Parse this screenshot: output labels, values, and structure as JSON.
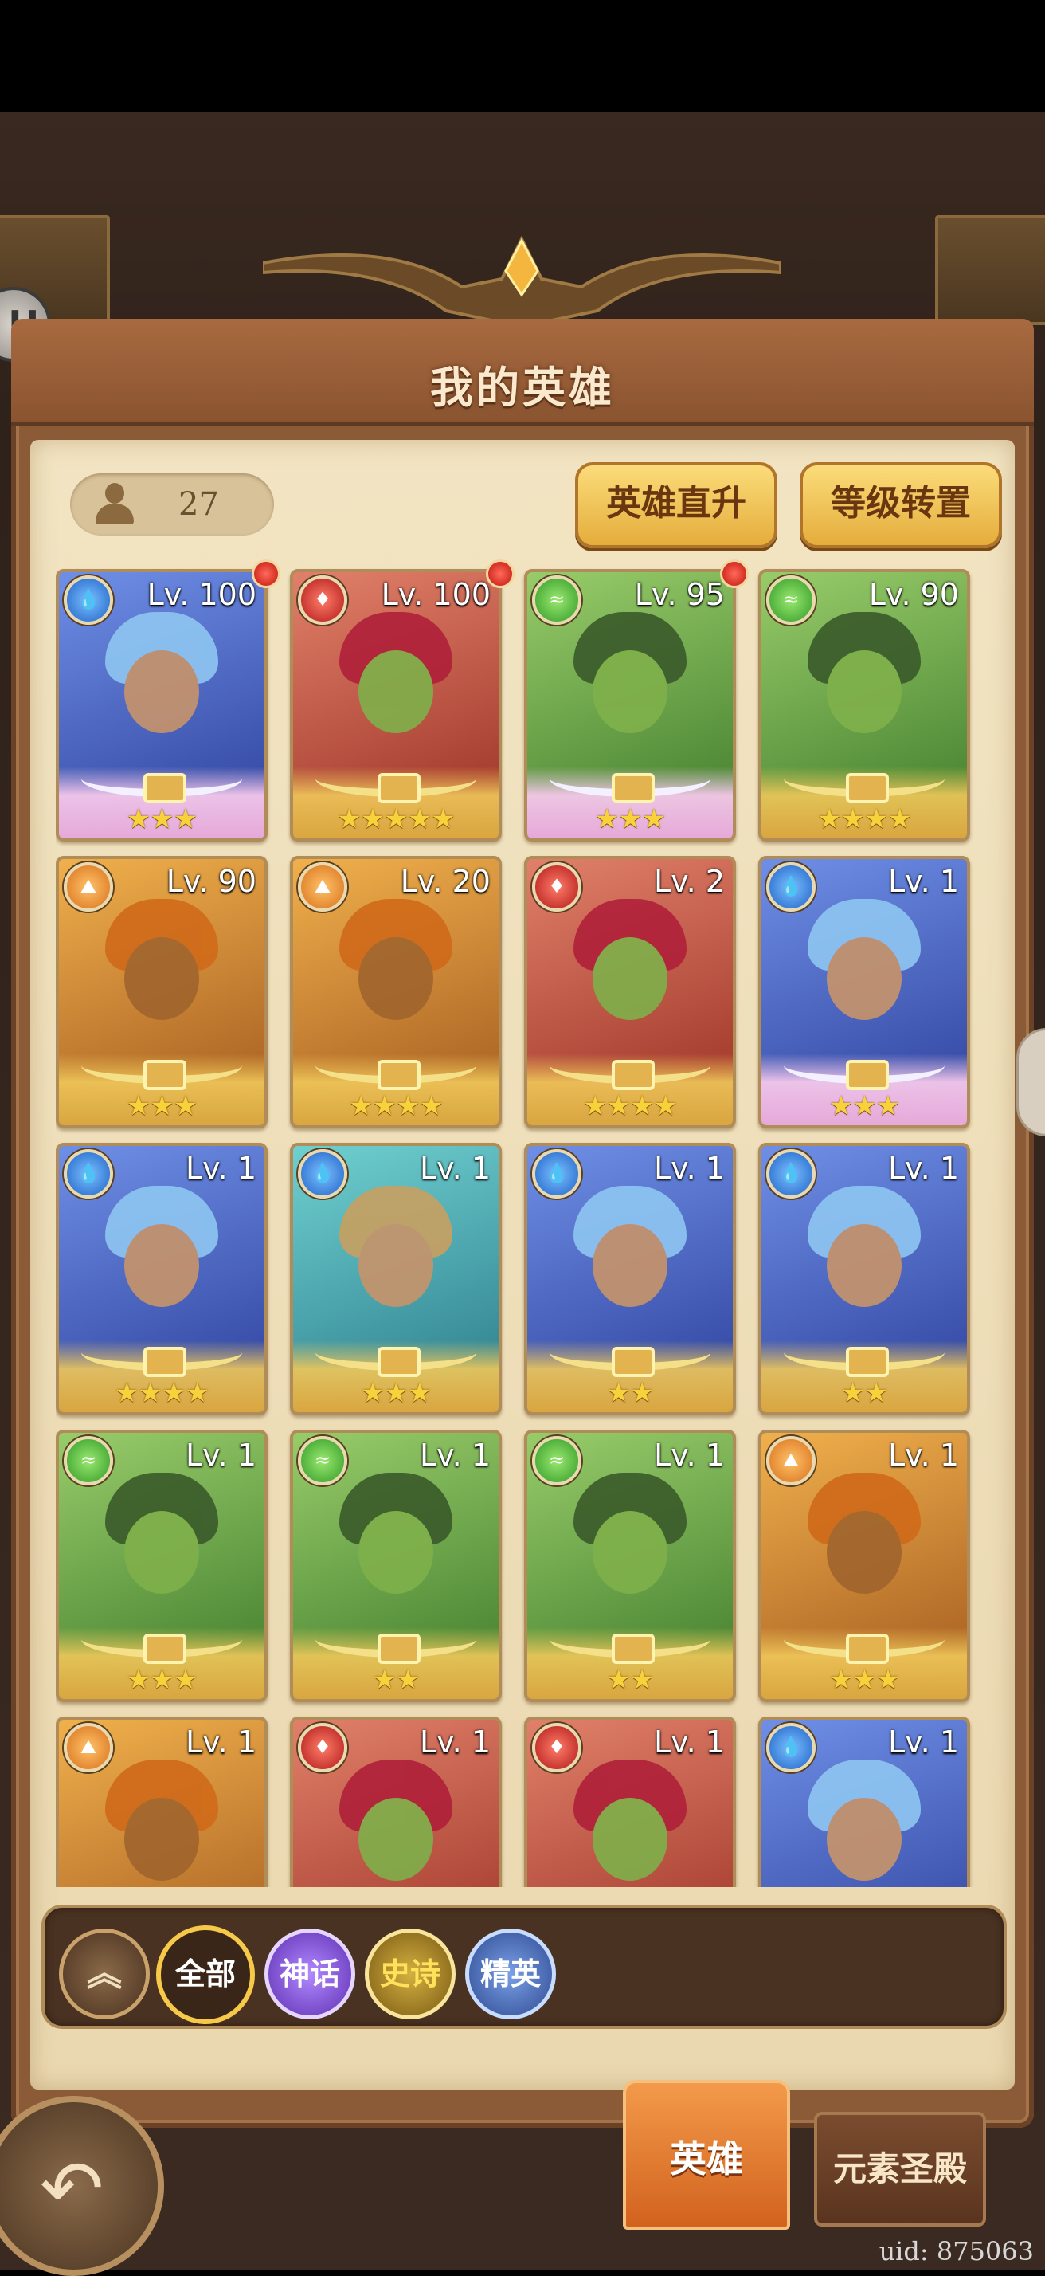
{
  "window": {
    "title": "我的英雄"
  },
  "hero_count": "27",
  "buttons": {
    "direct_upgrade": "英雄直升",
    "level_transfer": "等级转置"
  },
  "heroes": [
    {
      "level": "Lv. 100",
      "element": "water",
      "stars": "★★★",
      "rarity": "mythic",
      "bg": "blue",
      "alert": true
    },
    {
      "level": "Lv. 100",
      "element": "fire",
      "stars": "★★★★★",
      "rarity": "epic",
      "bg": "red",
      "alert": true
    },
    {
      "level": "Lv. 95",
      "element": "wind",
      "stars": "★★★",
      "rarity": "mythic",
      "bg": "green",
      "alert": true
    },
    {
      "level": "Lv. 90",
      "element": "wind",
      "stars": "★★★★",
      "rarity": "epic",
      "bg": "green",
      "alert": false
    },
    {
      "level": "Lv. 90",
      "element": "earth",
      "stars": "★★★",
      "rarity": "epic",
      "bg": "orange",
      "alert": false
    },
    {
      "level": "Lv. 20",
      "element": "earth",
      "stars": "★★★★",
      "rarity": "elite",
      "bg": "orange",
      "alert": false
    },
    {
      "level": "Lv. 2",
      "element": "fire",
      "stars": "★★★★",
      "rarity": "elite",
      "bg": "red",
      "alert": false
    },
    {
      "level": "Lv. 1",
      "element": "water",
      "stars": "★★★",
      "rarity": "mythic",
      "bg": "blue",
      "alert": false
    },
    {
      "level": "Lv. 1",
      "element": "water",
      "stars": "★★★★",
      "rarity": "epic",
      "bg": "blue",
      "alert": false
    },
    {
      "level": "Lv. 1",
      "element": "water",
      "stars": "★★★",
      "rarity": "epic",
      "bg": "teal",
      "alert": false
    },
    {
      "level": "Lv. 1",
      "element": "water",
      "stars": "★★",
      "rarity": "epic",
      "bg": "blue",
      "alert": false
    },
    {
      "level": "Lv. 1",
      "element": "water",
      "stars": "★★",
      "rarity": "epic",
      "bg": "blue",
      "alert": false
    },
    {
      "level": "Lv. 1",
      "element": "wind",
      "stars": "★★★",
      "rarity": "epic",
      "bg": "green",
      "alert": false
    },
    {
      "level": "Lv. 1",
      "element": "wind",
      "stars": "★★",
      "rarity": "epic",
      "bg": "green",
      "alert": false
    },
    {
      "level": "Lv. 1",
      "element": "wind",
      "stars": "★★",
      "rarity": "epic",
      "bg": "green",
      "alert": false
    },
    {
      "level": "Lv. 1",
      "element": "earth",
      "stars": "★★★",
      "rarity": "epic",
      "bg": "orange",
      "alert": false
    },
    {
      "level": "Lv. 1",
      "element": "earth",
      "stars": "",
      "rarity": "epic",
      "bg": "orange",
      "alert": false
    },
    {
      "level": "Lv. 1",
      "element": "fire",
      "stars": "",
      "rarity": "epic",
      "bg": "red",
      "alert": false
    },
    {
      "level": "Lv. 1",
      "element": "fire",
      "stars": "",
      "rarity": "epic",
      "bg": "red",
      "alert": false
    },
    {
      "level": "Lv. 1",
      "element": "water",
      "stars": "",
      "rarity": "epic",
      "bg": "blue",
      "alert": false
    }
  ],
  "filters": {
    "up": "︽",
    "all": "全部",
    "mythic": "神话",
    "epic": "史诗",
    "elite": "精英"
  },
  "nav": {
    "back": "↶",
    "hero_tab": "英雄",
    "shrine_tab": "元素圣殿"
  },
  "uid": "uid: 875063",
  "colors": {
    "panel": "#8b5a37",
    "parchment": "#f2e4c2",
    "accent": "#f7c948"
  }
}
